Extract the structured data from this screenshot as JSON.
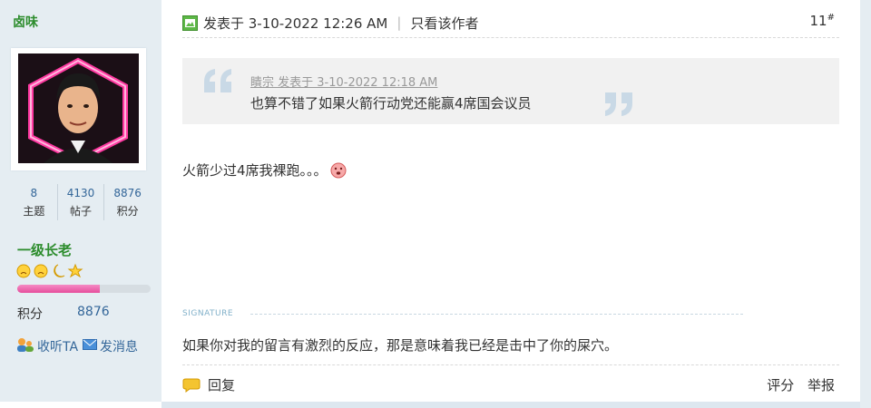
{
  "user": {
    "name": "卤味",
    "stats": [
      {
        "num": "8",
        "label": "主题"
      },
      {
        "num": "4130",
        "label": "帖子"
      },
      {
        "num": "8876",
        "label": "积分"
      }
    ],
    "rank": "一级长老",
    "level_progress": 0.62,
    "points_label": "积分",
    "points_value": "8876",
    "follow_label": "收听TA",
    "message_label": "发消息"
  },
  "post": {
    "posted_prefix": "发表于 3-10-2022 12:26 AM",
    "separator": "|",
    "only_author": "只看该作者",
    "floor_number": "11",
    "floor_mark": "#",
    "quote": {
      "meta": "瞶宗 发表于 3-10-2022 12:18 AM",
      "text": "也算不错了如果火箭行动党还能赢4席国会议员"
    },
    "body": "火箭少过4席我裸跑。。。",
    "signature_label": "SIGNATURE",
    "signature": "如果你对我的留言有激烈的反应，那是意味着我已经是击中了你的屎穴。",
    "reply_label": "回复",
    "rate_label": "评分",
    "report_label": "举报"
  }
}
